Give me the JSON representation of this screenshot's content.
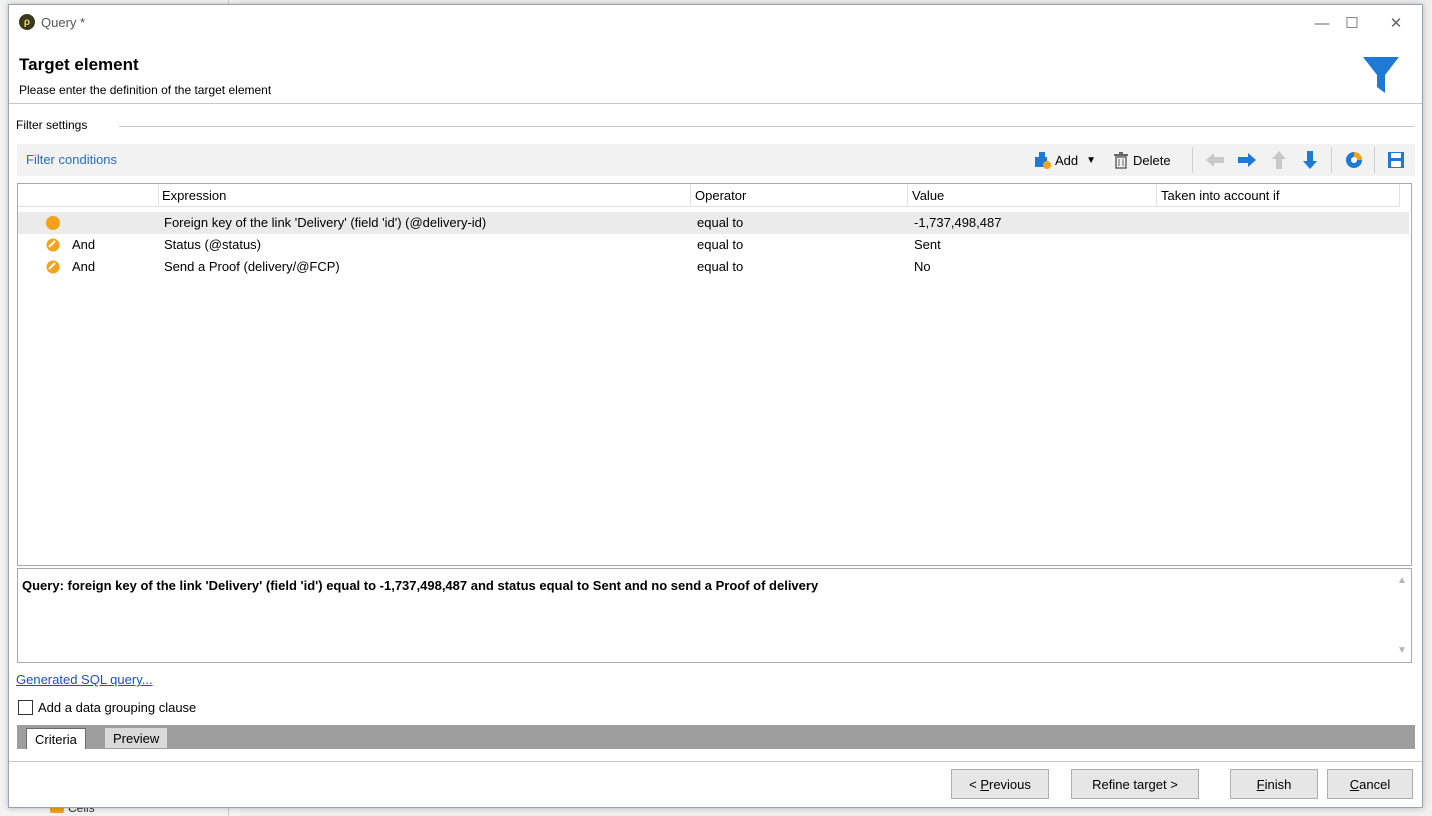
{
  "window": {
    "title": "Query *",
    "minimize": "—",
    "maximize": "☐",
    "close": "✕"
  },
  "header": {
    "title": "Target element",
    "subtitle": "Please enter the definition of the target element"
  },
  "filter_settings": {
    "legend": "Filter settings"
  },
  "toolbar": {
    "label": "Filter conditions",
    "add": "Add",
    "delete": "Delete"
  },
  "grid": {
    "columns": [
      "Expression",
      "Operator",
      "Value",
      "Taken into account if"
    ],
    "rows": [
      {
        "connector": "",
        "expression": "Foreign key of the link 'Delivery' (field 'id') (@delivery-id)",
        "operator": "equal to",
        "value": "-1,737,498,487",
        "taken": ""
      },
      {
        "connector": "And",
        "expression": "Status (@status)",
        "operator": "equal to",
        "value": "Sent",
        "taken": ""
      },
      {
        "connector": "And",
        "expression": "Send a Proof (delivery/@FCP)",
        "operator": "equal to",
        "value": "No",
        "taken": ""
      }
    ]
  },
  "summary": "Query: foreign key of the link 'Delivery' (field 'id') equal to -1,737,498,487 and status equal to Sent and no send a Proof of delivery",
  "sql_link": "Generated SQL query...",
  "grouping_checkbox": {
    "label": "Add a data grouping clause",
    "checked": false
  },
  "tabs": [
    "Criteria",
    "Preview"
  ],
  "buttons": {
    "previous_prefix": "< ",
    "previous_mnemonic": "P",
    "previous_rest": "revious",
    "refine": "Refine target >",
    "finish_mnemonic": "F",
    "finish_rest": "inish",
    "cancel_mnemonic": "C",
    "cancel_rest": "ancel"
  },
  "background": {
    "item_label": "Cells"
  },
  "colors": {
    "accent_blue": "#1f7ad6",
    "link": "#1a4fd0",
    "orange": "#f2a31b"
  }
}
